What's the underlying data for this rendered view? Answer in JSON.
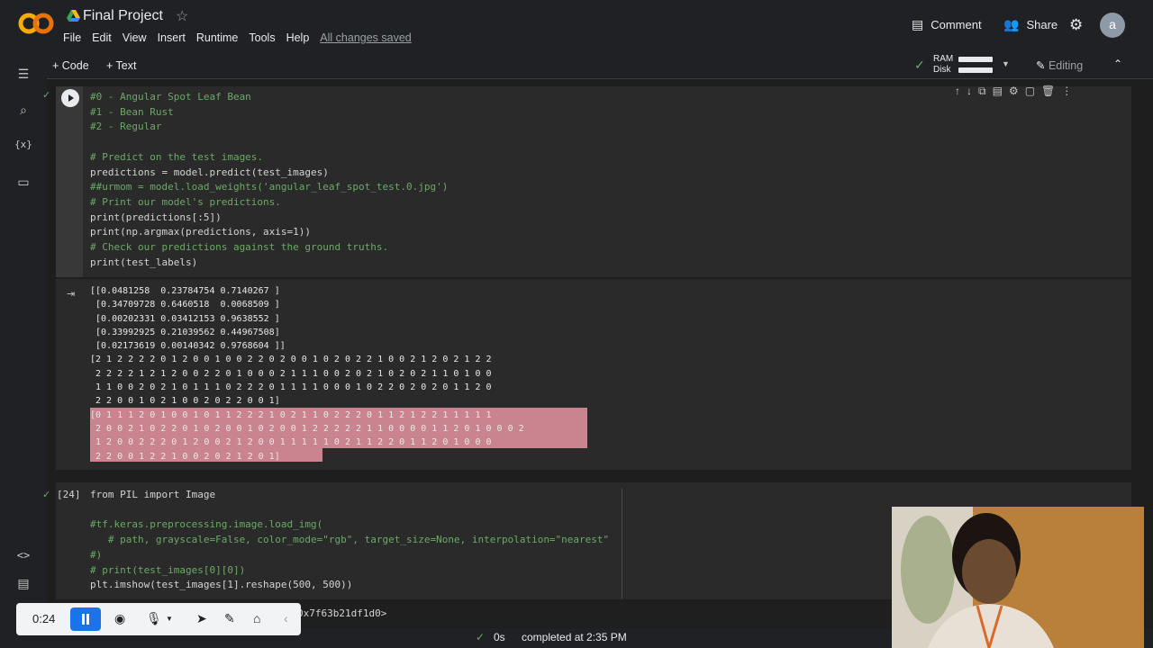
{
  "app": {
    "title": "Final Project",
    "menu": [
      "File",
      "Edit",
      "View",
      "Insert",
      "Runtime",
      "Tools",
      "Help"
    ],
    "saved_status": "All changes saved",
    "comment_label": "Comment",
    "share_label": "Share",
    "avatar_letter": "a"
  },
  "toolbar": {
    "add_code": "+ Code",
    "add_text": "+ Text",
    "ram_label": "RAM",
    "disk_label": "Disk",
    "editing_label": "Editing"
  },
  "cell1": {
    "lines": [
      {
        "text": "#0 - Angular Spot Leaf Bean",
        "kind": "comment"
      },
      {
        "text": "#1 - Bean Rust",
        "kind": "comment"
      },
      {
        "text": "#2 - Regular",
        "kind": "comment"
      },
      {
        "text": "",
        "kind": "code"
      },
      {
        "text": "# Predict on the test images.",
        "kind": "comment"
      },
      {
        "text": "predictions = model.predict(test_images)",
        "kind": "code"
      },
      {
        "text": "##urmom = model.load_weights('angular_leaf_spot_test.0.jpg')",
        "kind": "comment"
      },
      {
        "text": "# Print our model's predictions.",
        "kind": "comment"
      },
      {
        "text": "print(predictions[:5])",
        "kind": "code"
      },
      {
        "text": "print(np.argmax(predictions, axis=1))",
        "kind": "code"
      },
      {
        "text": "# Check our predictions against the ground truths.",
        "kind": "comment"
      },
      {
        "text": "print(test_labels)",
        "kind": "code"
      }
    ]
  },
  "output1": {
    "lines": [
      "[[0.0481258  0.23784754 0.7140267 ]",
      " [0.34709728 0.6460518  0.0068509 ]",
      " [0.00202331 0.03412153 0.9638552 ]",
      " [0.33992925 0.21039562 0.44967508]",
      " [0.02173619 0.00140342 0.9768604 ]]",
      "[2 1 2 2 2 2 0 1 2 0 0 1 0 0 2 2 0 2 0 0 1 0 2 0 2 2 1 0 0 2 1 2 0 2 1 2 2",
      " 2 2 2 2 1 2 1 2 0 0 2 2 0 1 0 0 0 2 1 1 1 0 0 2 0 2 1 0 2 0 2 1 1 0 1 0 0",
      " 1 1 0 0 2 0 2 1 0 1 1 1 0 2 2 2 0 1 1 1 1 0 0 0 1 0 2 2 0 2 0 2 0 1 1 2 0",
      " 2 2 0 0 1 0 2 1 0 0 2 0 2 2 0 0 1]",
      "[0 1 1 1 2 0 1 0 0 1 0 1 1 2 2 2 1 0 2 1 1 0 2 2 2 0 1 1 2 1 2 2 1 1 1 1 1",
      " 2 0 0 2 1 0 2 2 0 1 0 2 0 0 1 0 2 0 0 1 2 2 2 2 2 1 1 0 0 0 0 1 1 2 0 1 0 0 0 2",
      " 1 2 0 0 2 2 2 0 1 2 0 0 2 1 2 0 0 1 1 1 1 1 0 2 1 1 2 2 0 1 1 2 0 1 0 0 0",
      " 2 2 0 0 1 2 2 1 0 0 2 0 2 1 2 0 1]"
    ]
  },
  "cell2": {
    "exec_count": "[24]",
    "lines": [
      {
        "text": "from PIL import Image",
        "kind": "code"
      },
      {
        "text": "",
        "kind": "code"
      },
      {
        "text": "#tf.keras.preprocessing.image.load_img(",
        "kind": "comment"
      },
      {
        "text": "   # path, grayscale=False, color_mode=\"rgb\", target_size=None, interpolation=\"nearest\"",
        "kind": "comment"
      },
      {
        "text": "#)",
        "kind": "comment"
      },
      {
        "text": "# print(test_images[0][0])",
        "kind": "comment"
      },
      {
        "text": "plt.imshow(test_images[1].reshape(500, 500))",
        "kind": "code"
      }
    ],
    "output_partial": "0x7f63b21df1d0>"
  },
  "status": {
    "duration": "0s",
    "message": "completed at 2:35 PM"
  },
  "recorder": {
    "time": "0:24"
  }
}
